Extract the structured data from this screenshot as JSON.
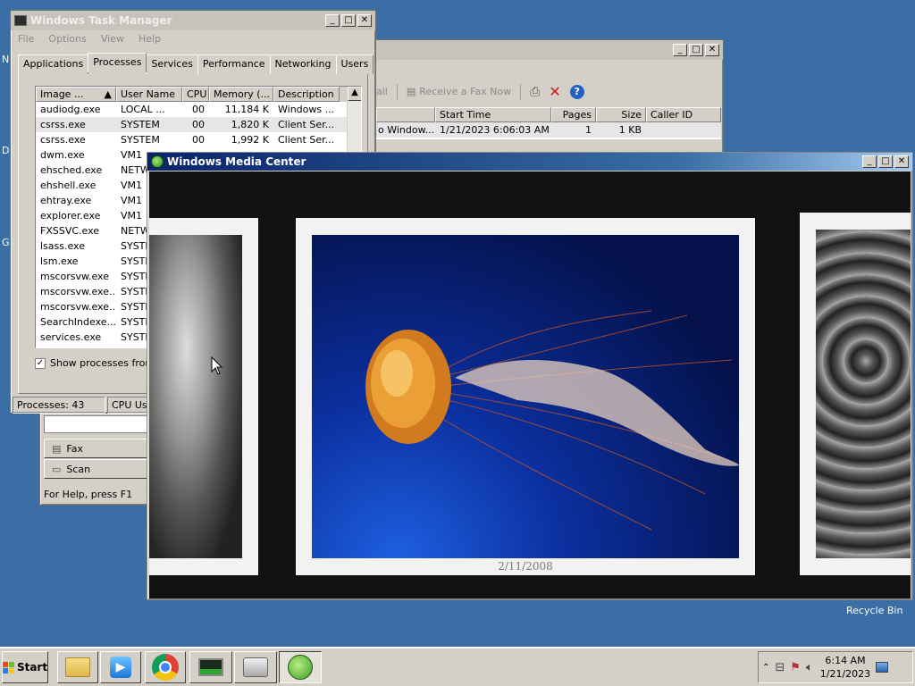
{
  "desktop": {
    "recycle_bin": "Recycle Bin",
    "edge_letters": [
      "N",
      "D",
      "G"
    ]
  },
  "fax_window": {
    "toolbar": {
      "email_partial": "ail",
      "receive_fax": "Receive a Fax Now"
    },
    "columns": [
      "Start Time",
      "Pages",
      "Size",
      "Caller ID"
    ],
    "row": {
      "name_partial": "o Window...",
      "start_time": "1/21/2023 6:06:03 AM",
      "pages": "1",
      "size": "1 KB"
    },
    "folders": [
      "Fax",
      "Scan"
    ],
    "status": "For Help, press F1"
  },
  "task_manager": {
    "title": "Windows Task Manager",
    "menu": [
      "File",
      "Options",
      "View",
      "Help"
    ],
    "tabs": [
      "Applications",
      "Processes",
      "Services",
      "Performance",
      "Networking",
      "Users"
    ],
    "active_tab": "Processes",
    "columns": [
      "Image ...",
      "User Name",
      "CPU",
      "Memory (...",
      "Description"
    ],
    "processes": [
      {
        "image": "audiodg.exe",
        "user": "LOCAL ...",
        "cpu": "00",
        "mem": "11,184 K",
        "desc": "Windows ..."
      },
      {
        "image": "csrss.exe",
        "user": "SYSTEM",
        "cpu": "00",
        "mem": "1,820 K",
        "desc": "Client Ser..."
      },
      {
        "image": "csrss.exe",
        "user": "SYSTEM",
        "cpu": "00",
        "mem": "1,992 K",
        "desc": "Client Ser..."
      },
      {
        "image": "dwm.exe",
        "user": "VM1",
        "cpu": "",
        "mem": "",
        "desc": ""
      },
      {
        "image": "ehsched.exe",
        "user": "NETW",
        "cpu": "",
        "mem": "",
        "desc": ""
      },
      {
        "image": "ehshell.exe",
        "user": "VM1",
        "cpu": "",
        "mem": "",
        "desc": ""
      },
      {
        "image": "ehtray.exe",
        "user": "VM1",
        "cpu": "",
        "mem": "",
        "desc": ""
      },
      {
        "image": "explorer.exe",
        "user": "VM1",
        "cpu": "",
        "mem": "",
        "desc": ""
      },
      {
        "image": "FXSSVC.exe",
        "user": "NETW",
        "cpu": "",
        "mem": "",
        "desc": ""
      },
      {
        "image": "lsass.exe",
        "user": "SYSTE",
        "cpu": "",
        "mem": "",
        "desc": ""
      },
      {
        "image": "lsm.exe",
        "user": "SYSTE",
        "cpu": "",
        "mem": "",
        "desc": ""
      },
      {
        "image": "mscorsvw.exe",
        "user": "SYSTE",
        "cpu": "",
        "mem": "",
        "desc": ""
      },
      {
        "image": "mscorsvw.exe...",
        "user": "SYSTE",
        "cpu": "",
        "mem": "",
        "desc": ""
      },
      {
        "image": "mscorsvw.exe...",
        "user": "SYSTE",
        "cpu": "",
        "mem": "",
        "desc": ""
      },
      {
        "image": "SearchIndexe...",
        "user": "SYSTE",
        "cpu": "",
        "mem": "",
        "desc": ""
      },
      {
        "image": "services.exe",
        "user": "SYSTE",
        "cpu": "",
        "mem": "",
        "desc": ""
      }
    ],
    "show_all_label": "Show processes from a",
    "status": {
      "processes": "Processes: 43",
      "cpu": "CPU Usa"
    }
  },
  "media_center": {
    "title": "Windows Media Center",
    "photo_date": "2/11/2008"
  },
  "taskbar": {
    "start": "Start",
    "time": "6:14 AM",
    "date": "1/21/2023"
  },
  "colors": {
    "desktop": "#3a6ea5",
    "active_title": "#0a246a",
    "jellyfish_blue": "#0b2f9e"
  }
}
